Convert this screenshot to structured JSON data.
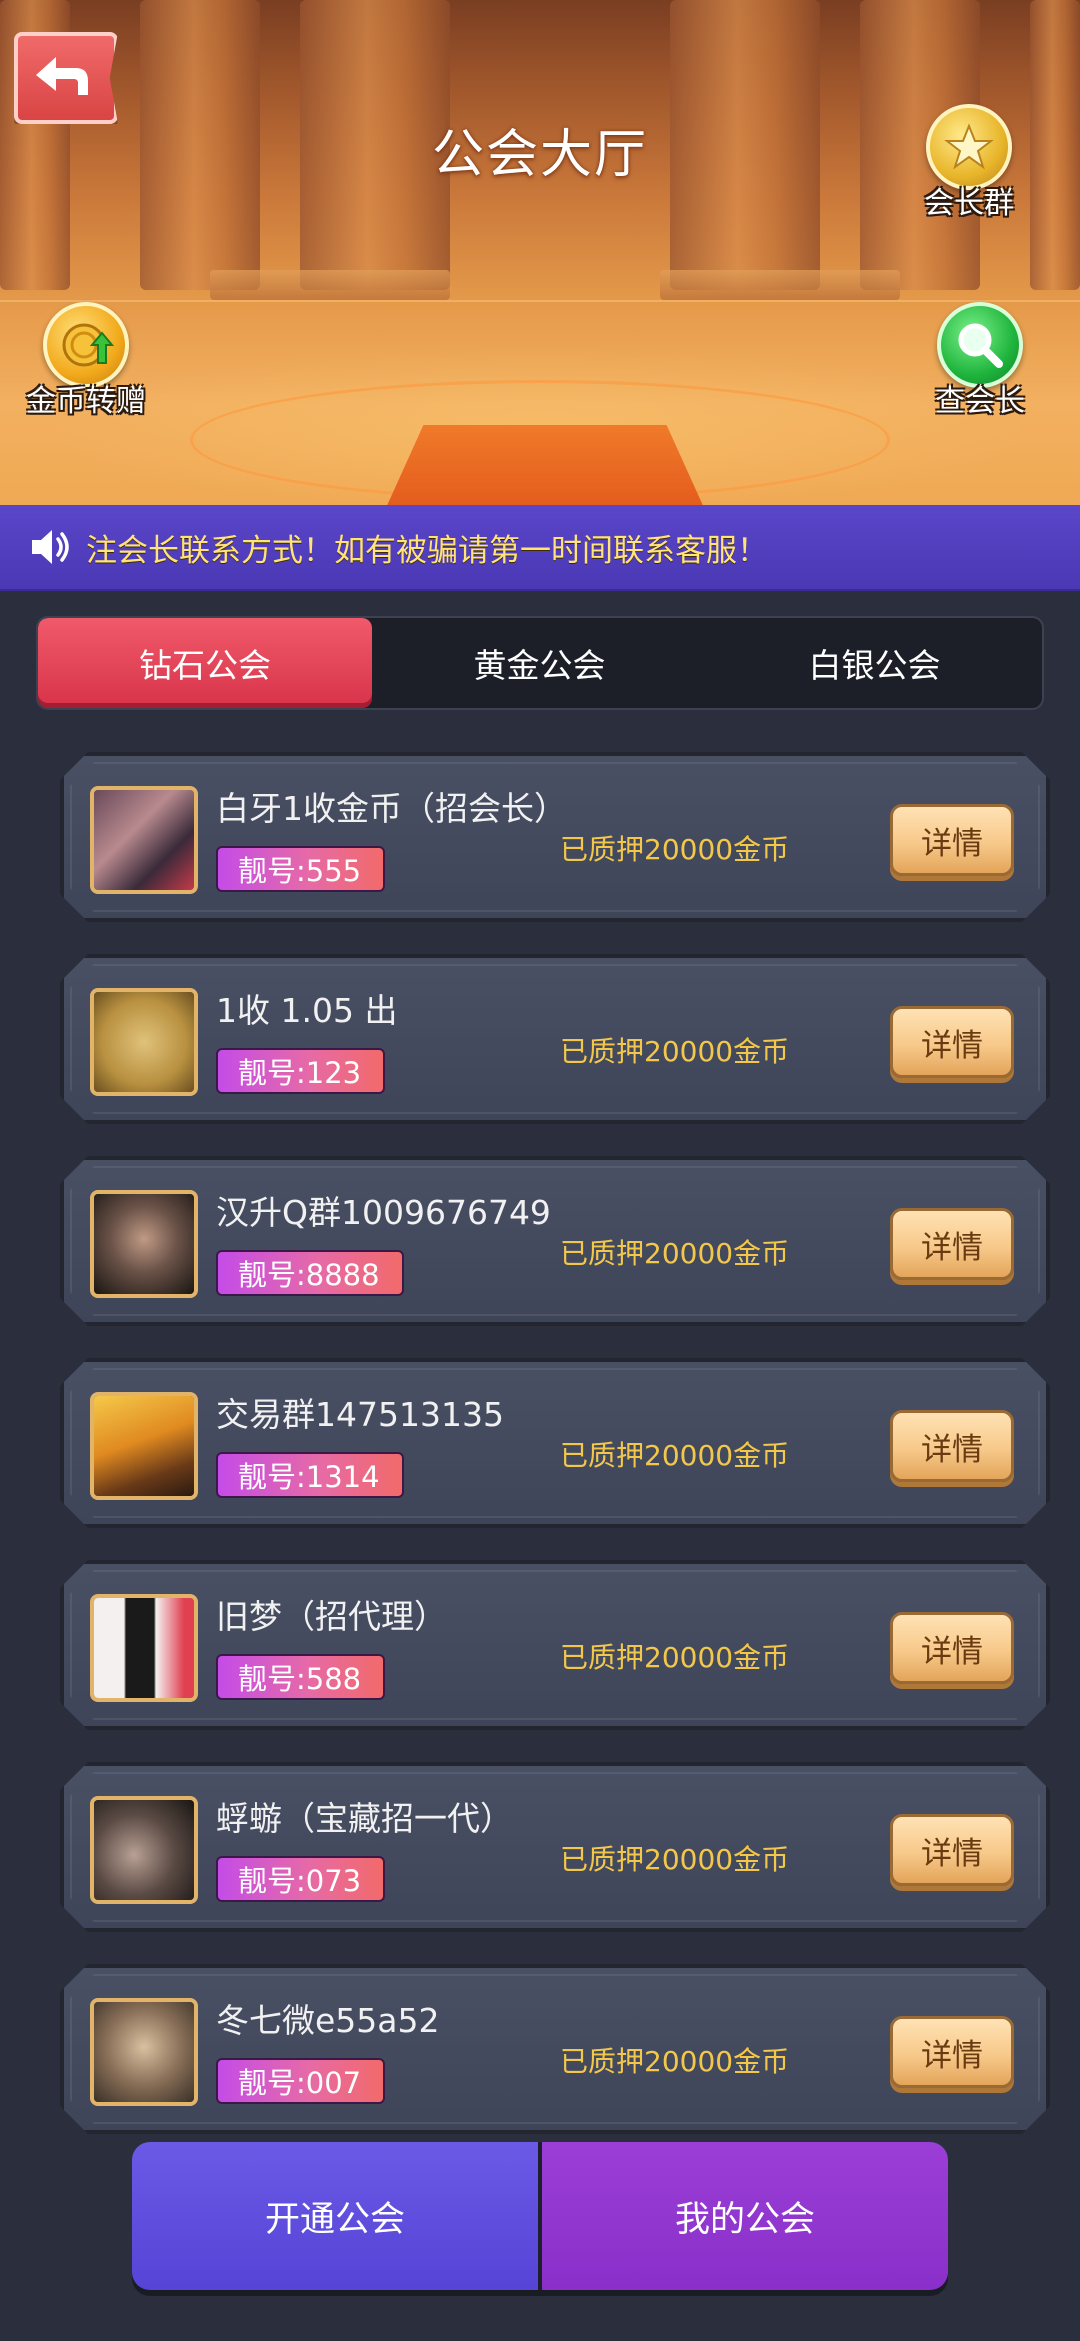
{
  "header": {
    "title": "公会大厅",
    "back_icon": "back-arrow-icon",
    "leader_group_label": "会长群",
    "coin_transfer_label": "金币转赠",
    "search_leader_label": "查会长"
  },
  "notice": {
    "icon": "speaker-icon",
    "text": "注会长联系方式！如有被骗请第一时间联系客服！"
  },
  "tabs": [
    {
      "label": "钻石公会",
      "active": true
    },
    {
      "label": "黄金公会",
      "active": false
    },
    {
      "label": "白银公会",
      "active": false
    }
  ],
  "guilds": [
    {
      "name": "白牙1收金币（招会长）",
      "badge": "靓号:555",
      "pledge": "已质押20000金币",
      "detail": "详情"
    },
    {
      "name": "1收 1.05 出",
      "badge": "靓号:123",
      "pledge": "已质押20000金币",
      "detail": "详情"
    },
    {
      "name": "汉升Q群1009676749",
      "badge": "靓号:8888",
      "pledge": "已质押20000金币",
      "detail": "详情"
    },
    {
      "name": "交易群147513135",
      "badge": "靓号:1314",
      "pledge": "已质押20000金币",
      "detail": "详情"
    },
    {
      "name": "旧梦（招代理）",
      "badge": "靓号:588",
      "pledge": "已质押20000金币",
      "detail": "详情"
    },
    {
      "name": "蜉蝣（宝藏招一代）",
      "badge": "靓号:073",
      "pledge": "已质押20000金币",
      "detail": "详情"
    },
    {
      "name": "冬七微e55a52",
      "badge": "靓号:007",
      "pledge": "已质押20000金币",
      "detail": "详情"
    }
  ],
  "bottom": {
    "open_label": "开通公会",
    "mine_label": "我的公会"
  },
  "colors": {
    "accent_tab": "#d8334a",
    "badge_gradient_start": "#c44ce8",
    "pledge_text": "#f3c84a",
    "notice_bg": "#4a38b4"
  }
}
